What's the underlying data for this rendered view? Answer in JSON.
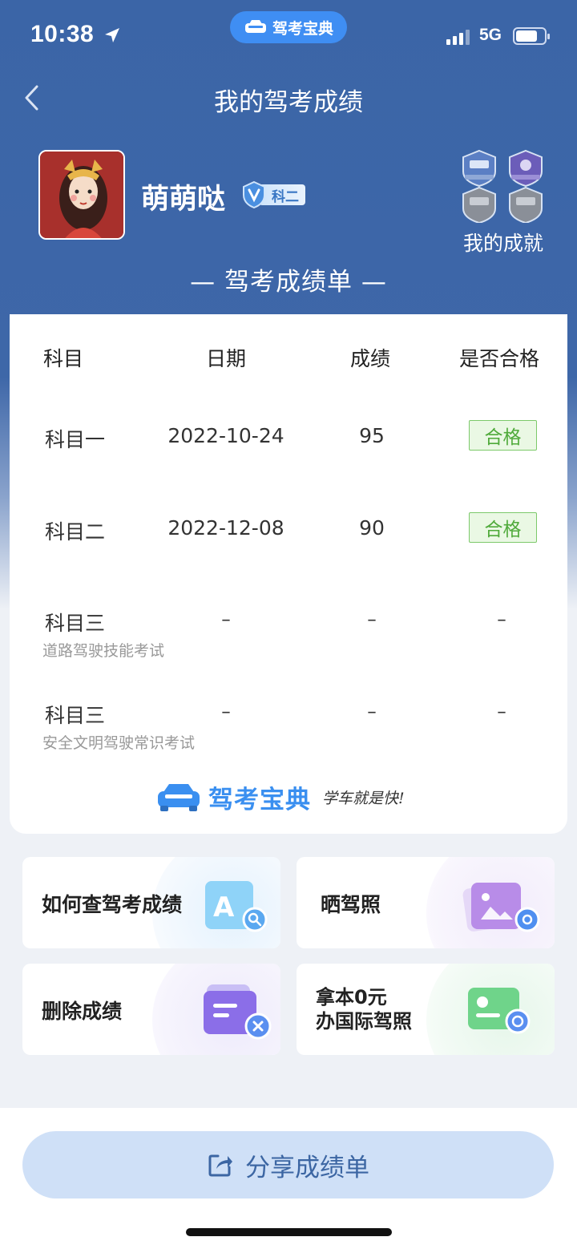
{
  "status_bar": {
    "time": "10:38",
    "network": "5G",
    "app_pill": "驾考宝典"
  },
  "header": {
    "title": "我的驾考成绩"
  },
  "profile": {
    "username": "萌萌哒",
    "level_tag": "科二",
    "achievements_label": "我的成就"
  },
  "sheet": {
    "title": "— 驾考成绩单 —",
    "columns": [
      "科目",
      "日期",
      "成绩",
      "是否合格"
    ],
    "rows": [
      {
        "subject": "科目一",
        "note": "",
        "date": "2022-10-24",
        "score": "95",
        "result": "合格"
      },
      {
        "subject": "科目二",
        "note": "",
        "date": "2022-12-08",
        "score": "90",
        "result": "合格"
      },
      {
        "subject": "科目三",
        "note": "道路驾驶技能考试",
        "date": "–",
        "score": "–",
        "result": "–"
      },
      {
        "subject": "科目三",
        "note": "安全文明驾驶常识考试",
        "date": "–",
        "score": "–",
        "result": "–"
      }
    ],
    "brand_name": "驾考宝典",
    "brand_slogan": "学车就是快!"
  },
  "tiles": [
    {
      "label": "如何查驾考成绩"
    },
    {
      "label": "晒驾照"
    },
    {
      "label": "删除成绩"
    },
    {
      "label_line1": "拿本0元",
      "label_line2": "办国际驾照"
    }
  ],
  "share_button": {
    "label": "分享成绩单"
  },
  "colors": {
    "header_blue": "#3e67a8",
    "brand_blue": "#3a8ff0",
    "pass_green": "#4faa3a",
    "share_bg": "#cfe0f7"
  }
}
